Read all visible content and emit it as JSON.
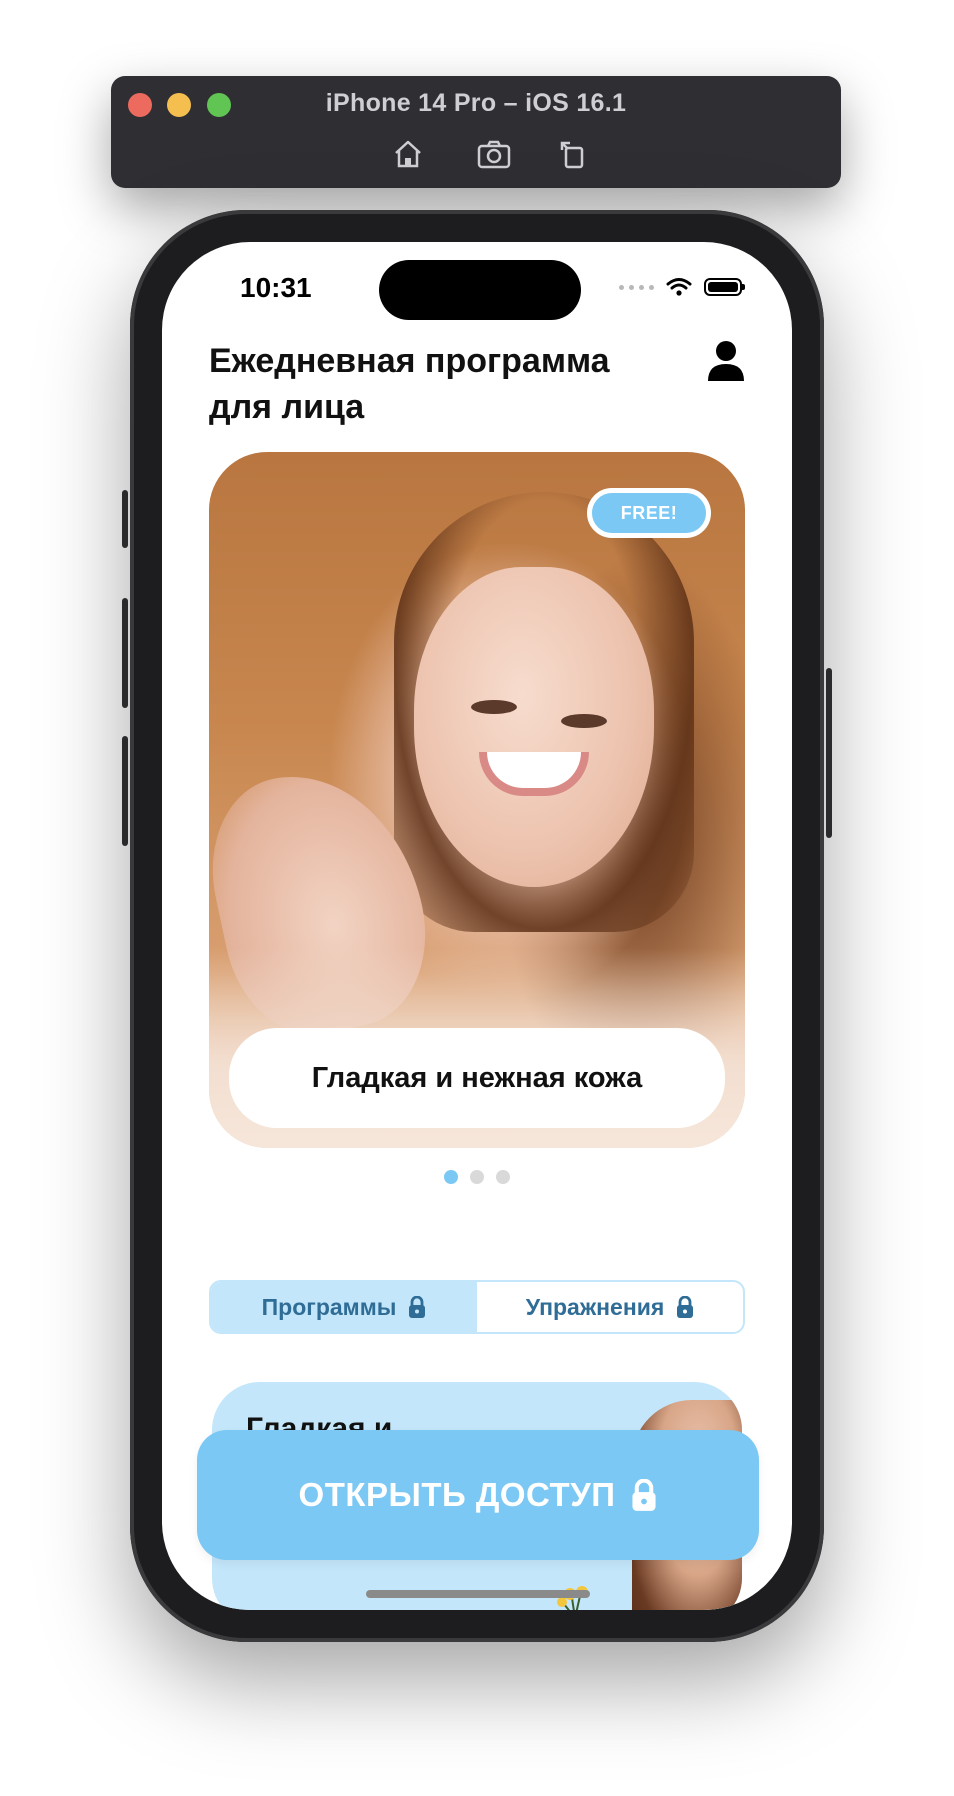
{
  "simulator": {
    "title": "iPhone 14 Pro – iOS 16.1",
    "tools": [
      "home-icon",
      "screenshot-icon",
      "rotate-icon"
    ]
  },
  "status_bar": {
    "time": "10:31"
  },
  "header": {
    "title": "Ежедневная программа для лица",
    "profile_icon": "person-icon"
  },
  "hero": {
    "badge": "FREE!",
    "caption": "Гладкая и нежная кожа",
    "page_count": 3,
    "active_page": 1
  },
  "tabs": [
    {
      "label": "Программы",
      "active": true,
      "icon": "lock-icon"
    },
    {
      "label": "Упражнения",
      "active": false,
      "icon": "lock-icon"
    }
  ],
  "program_card": {
    "title": "Гладкая и"
  },
  "cta": {
    "label": "ОТКРЫТЬ ДОСТУП",
    "icon": "lock-icon"
  },
  "colors": {
    "accent": "#7bc8f4",
    "accent_light": "#c4e6fa",
    "tab_text": "#2f6d96"
  }
}
